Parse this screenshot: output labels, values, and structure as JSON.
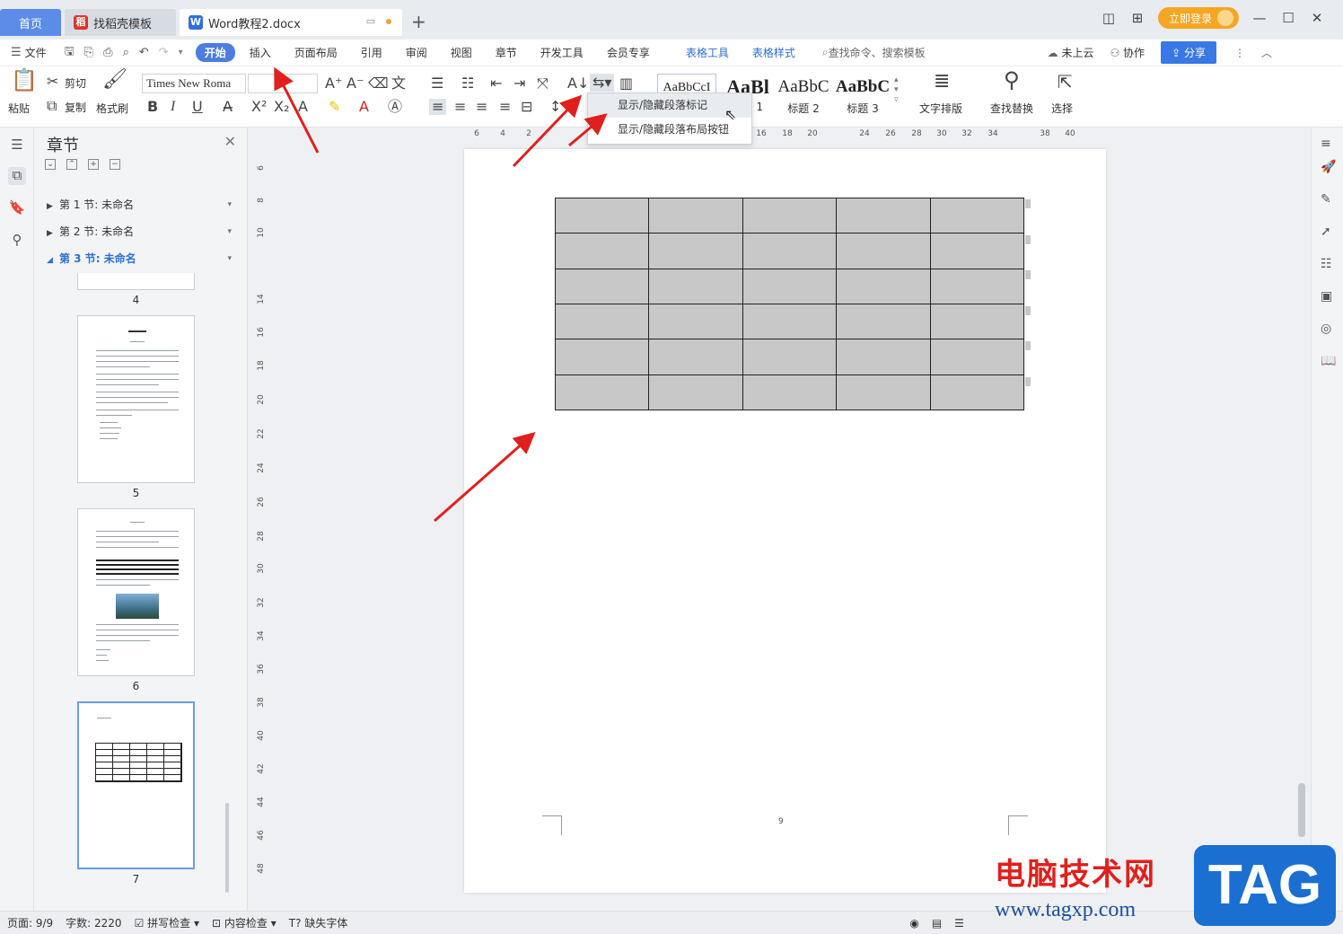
{
  "titlebar": {
    "tabs": [
      {
        "label": "首页"
      },
      {
        "label": "找稻壳模板"
      },
      {
        "label": "Word教程2.docx"
      }
    ],
    "login_label": "立即登录"
  },
  "menubar": {
    "file_label": "文件",
    "items": [
      "开始",
      "插入",
      "页面布局",
      "引用",
      "审阅",
      "视图",
      "章节",
      "开发工具",
      "会员专享"
    ],
    "context_items": [
      "表格工具",
      "表格样式"
    ],
    "search_placeholder": "查找命令、搜索模板",
    "cloud_label": "未上云",
    "collab_label": "协作",
    "share_label": "分享"
  },
  "ribbon": {
    "paste": "粘贴",
    "cut": "剪切",
    "copy": "复制",
    "format_painter": "格式刷",
    "font_name": "Times New Roma",
    "styles": [
      {
        "sample": "AaBbCcI",
        "label": ""
      },
      {
        "sample": "AaBl",
        "label": "1"
      },
      {
        "sample": "AaBbC",
        "label": "标题 2"
      },
      {
        "sample": "AaBbC",
        "label": "标题 3"
      }
    ],
    "text_layout": "文字排版",
    "find_replace": "查找替换",
    "select": "选择"
  },
  "dropdown": {
    "items": [
      "显示/隐藏段落标记",
      "显示/隐藏段落布局按钮"
    ]
  },
  "panel": {
    "title": "章节",
    "sections": [
      "第 1 节: 未命名",
      "第 2 节: 未命名",
      "第 3 节: 未命名"
    ],
    "thumb_numbers": [
      "4",
      "5",
      "6",
      "7"
    ]
  },
  "ruler": {
    "h_marks": [
      "6",
      "4",
      "2",
      "16",
      "18",
      "20",
      "24",
      "26",
      "28",
      "30",
      "32",
      "34",
      "38",
      "40"
    ],
    "v_marks": [
      "6",
      "8",
      "10",
      "14",
      "16",
      "18",
      "20",
      "22",
      "24",
      "26",
      "28",
      "30",
      "32",
      "34",
      "36",
      "38",
      "40",
      "42",
      "44",
      "46",
      "48"
    ]
  },
  "document": {
    "table_rows": 6,
    "table_cols": 5,
    "page_number": "9"
  },
  "statusbar": {
    "page": "页面: 9/9",
    "words": "字数: 2220",
    "spell": "拼写检查",
    "content_check": "内容检查",
    "missing_font": "缺失字体"
  },
  "watermark": {
    "text": "电脑技术网",
    "url": "www.tagxp.com",
    "tag": "TAG"
  },
  "colors": {
    "accent": "#4a7ee0",
    "annotation_arrow": "#e0201c",
    "table_fill": "#c8c8c8"
  }
}
